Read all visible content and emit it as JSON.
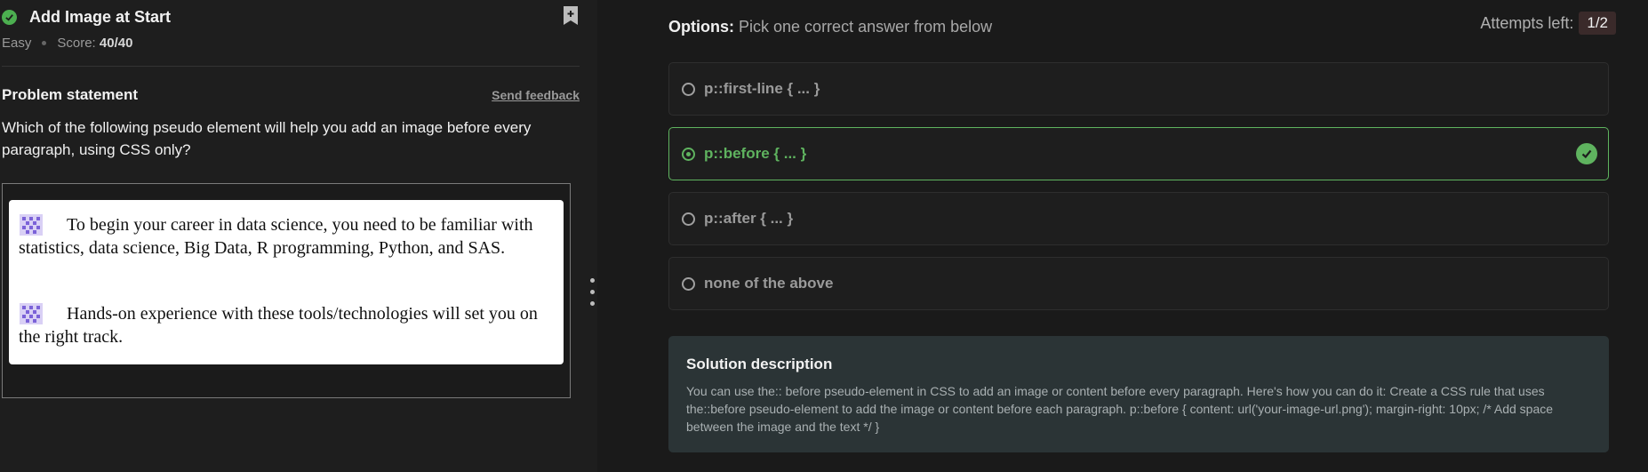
{
  "problem": {
    "title": "Add Image at Start",
    "difficulty": "Easy",
    "score_label": "Score:",
    "score_value": "40/40",
    "statement_heading": "Problem statement",
    "feedback_link": "Send feedback",
    "question": "Which of the following pseudo element will help you add an image before every paragraph, using CSS only?",
    "image_text": {
      "para1": "To begin your career in data science, you need to be familiar with statistics, data science, Big Data, R programming, Python, and SAS.",
      "para2": "Hands-on experience with these tools/technologies will set you on the right track."
    }
  },
  "options_panel": {
    "heading": "Options:",
    "instruction": "Pick one correct answer from below",
    "attempts_label": "Attempts left:",
    "attempts_value": "1/2",
    "options": [
      {
        "label": "p::first-line { ... }",
        "selected": false
      },
      {
        "label": "p::before { ... }",
        "selected": true,
        "correct": true
      },
      {
        "label": "p::after { ... }",
        "selected": false
      },
      {
        "label": "none of the above",
        "selected": false
      }
    ]
  },
  "solution": {
    "title": "Solution description",
    "body": "You can use the:: before pseudo-element in CSS to add an image or content before every paragraph. Here's how you can do it: Create a CSS rule that uses the::before pseudo-element to add the image or content before each paragraph. p::before { content: url('your-image-url.png'); margin-right: 10px; /* Add space between the image and the text */ }"
  },
  "colors": {
    "accent_green": "#5fb35f",
    "panel_dark": "#1e1e1e",
    "solution_bg": "#2b3436"
  }
}
